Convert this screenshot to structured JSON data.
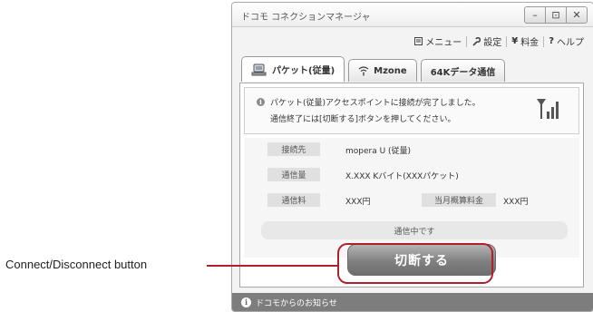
{
  "window": {
    "title": "ドコモ コネクションマネージャ",
    "controls": {
      "minimize": "–",
      "maximize": "⊡",
      "close": "✕"
    }
  },
  "menubar": {
    "menu_label": "メニュー",
    "settings_label": "設定",
    "fee_label": "料金",
    "help_label": "ヘルプ"
  },
  "tabs": [
    {
      "label": "パケット(従量)",
      "icon": "pc-network-icon",
      "active": true
    },
    {
      "label": "Mzone",
      "icon": "wifi-icon",
      "active": false
    },
    {
      "label": "64Kデータ通信",
      "icon": "",
      "active": false
    }
  ],
  "notice": {
    "line1": "パケット(従量)アクセスポイントに接続が完了しました。",
    "line2": "通信終了には[切断する]ボタンを押してください。"
  },
  "info": {
    "destination_label": "接続先",
    "destination_value": "mopera U (従量)",
    "traffic_label": "通信量",
    "traffic_value": "X.XXX Kバイト(XXXパケット)",
    "charge_label": "通信料",
    "charge_value": "XXX円",
    "monthly_label": "当月概算料金",
    "monthly_value": "XXX円"
  },
  "status_text": "通信中です",
  "disconnect_label": "切断する",
  "footer_label": "ドコモからのお知らせ",
  "callout_label": "Connect/Disconnect button",
  "colors": {
    "highlight": "#b0202a",
    "button": "#808080",
    "footer": "#7d7d7d"
  }
}
